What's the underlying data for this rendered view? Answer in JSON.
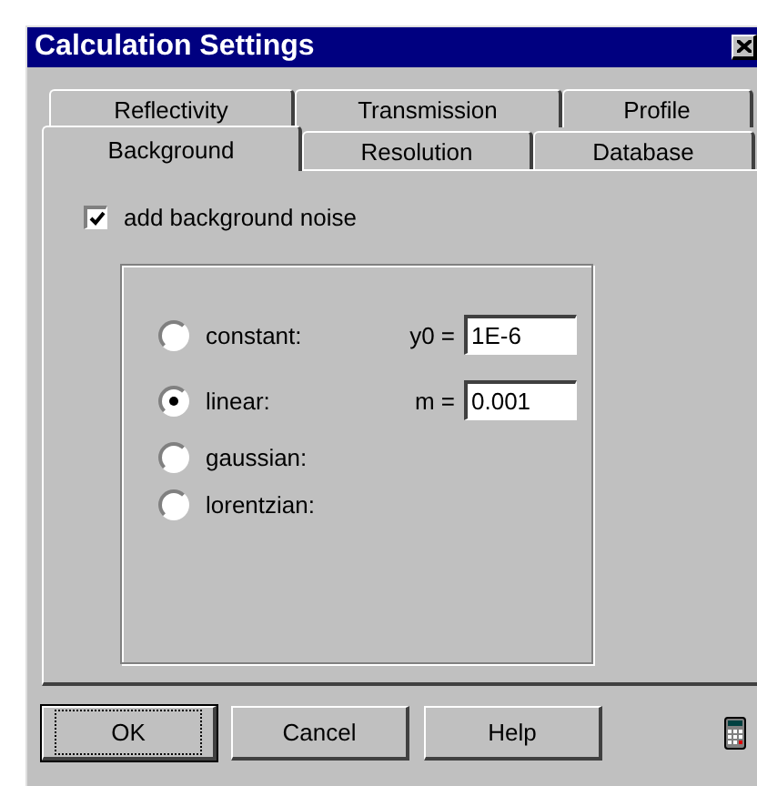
{
  "window": {
    "title": "Calculation Settings"
  },
  "tab_rows": [
    [
      {
        "label": "Reflectivity",
        "selected": false
      },
      {
        "label": "Transmission",
        "selected": false
      },
      {
        "label": "Profile",
        "selected": false
      }
    ],
    [
      {
        "label": "Background",
        "selected": true
      },
      {
        "label": "Resolution",
        "selected": false
      },
      {
        "label": "Database",
        "selected": false
      }
    ]
  ],
  "background_noise": {
    "label": "add background noise",
    "checked": true
  },
  "models": [
    {
      "label": "constant:",
      "selected": false,
      "param_label": "y0 =",
      "param_value": "1E-6"
    },
    {
      "label": "linear:",
      "selected": true,
      "param_label": "m =",
      "param_value": "0.001"
    },
    {
      "label": "gaussian:",
      "selected": false
    },
    {
      "label": "lorentzian:",
      "selected": false
    }
  ],
  "buttons": [
    {
      "label": "OK",
      "default": true
    },
    {
      "label": "Cancel",
      "default": false
    },
    {
      "label": "Help",
      "default": false
    }
  ]
}
